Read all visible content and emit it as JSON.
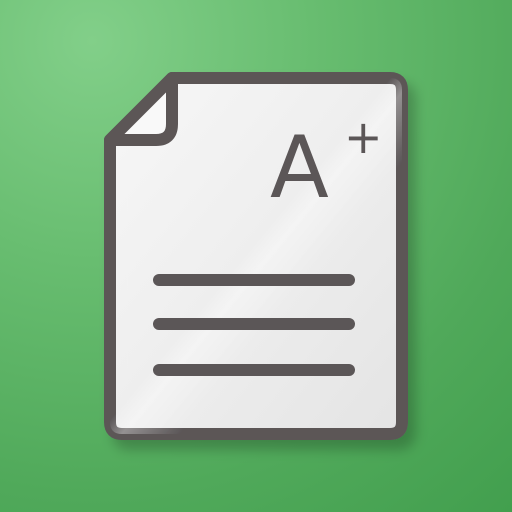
{
  "icon": {
    "name": "document-grade-icon",
    "grade_letter": "A",
    "grade_modifier": "+",
    "colors": {
      "background": "#5cb865",
      "paper": "#f1f1f1",
      "outline": "#5b5657",
      "text": "#5b5657"
    }
  }
}
